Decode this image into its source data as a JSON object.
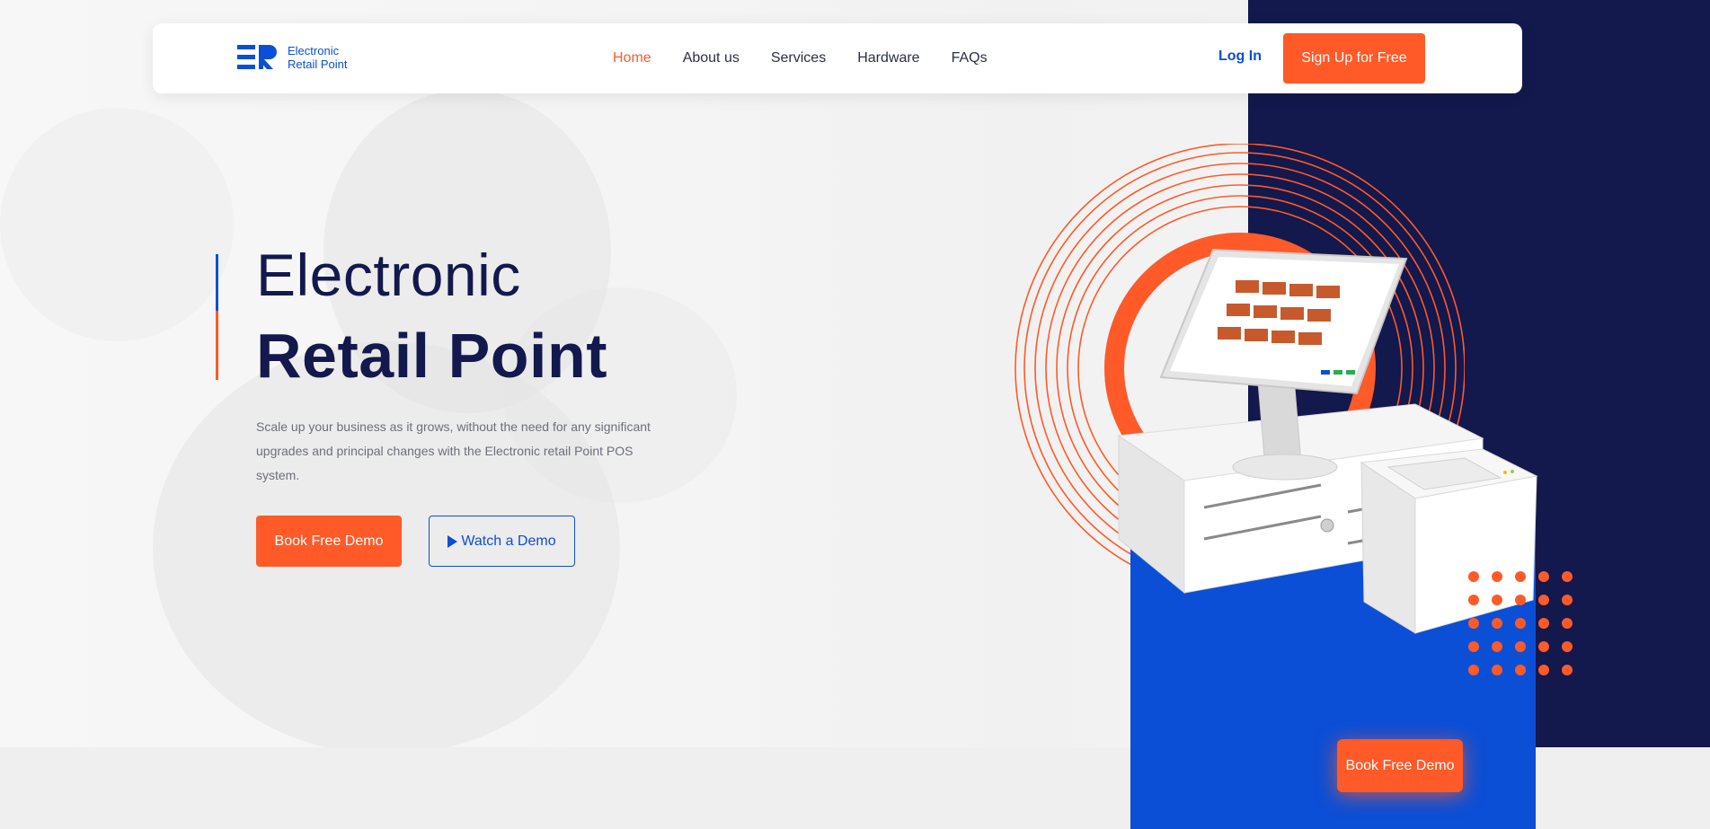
{
  "brand": {
    "line1": "Electronic",
    "line2": "Retail Point",
    "logo_icon": "er-logo-icon",
    "color": "#0b4fd6"
  },
  "nav": {
    "items": [
      {
        "label": "Home",
        "active": true
      },
      {
        "label": "About us",
        "active": false
      },
      {
        "label": "Services",
        "active": false
      },
      {
        "label": "Hardware",
        "active": false
      },
      {
        "label": "FAQs",
        "active": false
      }
    ],
    "login_label": "Log In",
    "signup_label": "Sign Up for Free"
  },
  "hero": {
    "title_line1": "Electronic",
    "title_line2": "Retail Point",
    "subtitle": "Scale up your business as it grows, without the need for any significant upgrades and principal changes with the Electronic retail Point POS system.",
    "book_demo_label": "Book Free Demo",
    "watch_demo_label": "Watch a Demo",
    "watch_icon": "play-icon"
  },
  "floating": {
    "book_demo_label": "Book Free Demo"
  },
  "colors": {
    "accent": "#ff5a28",
    "brand_blue": "#0b4fd6",
    "navy": "#13184d",
    "text_muted": "#6c6f7a"
  }
}
